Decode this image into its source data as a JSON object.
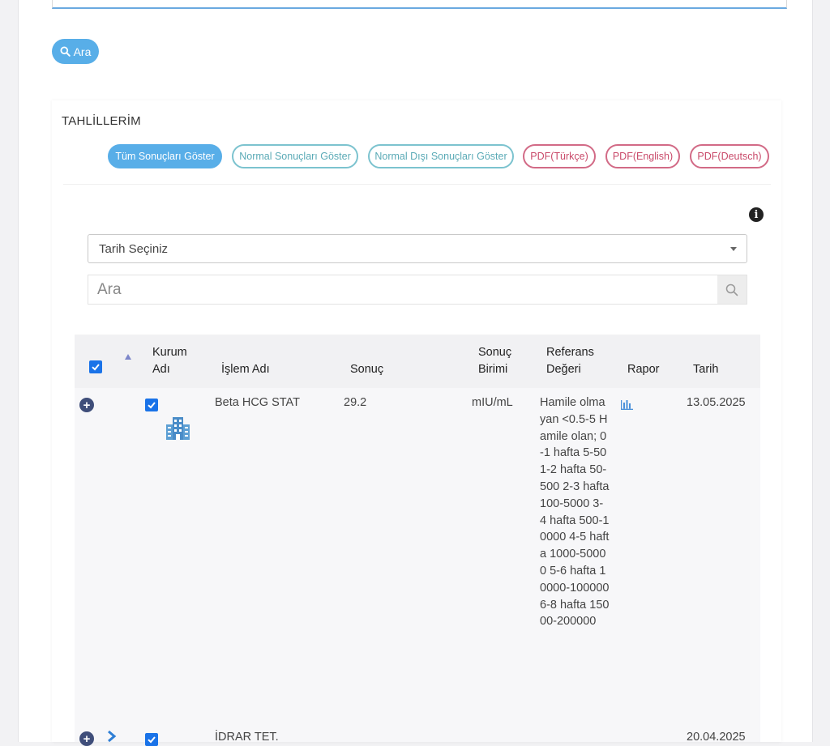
{
  "search_button": {
    "label": "Ara",
    "icon": "search-icon"
  },
  "panel": {
    "title": "TAHLİLLERİM",
    "filters": {
      "all": "Tüm Sonuçları Göster",
      "normal": "Normal Sonuçları Göster",
      "abnormal": "Normal Dışı Sonuçları Göster",
      "pdf_tr": "PDF(Türkçe)",
      "pdf_en": "PDF(English)",
      "pdf_de": "PDF(Deutsch)"
    },
    "info_icon": "info-icon"
  },
  "date_select": {
    "value": "Tarih Seçiniz"
  },
  "table_search": {
    "placeholder": "Ara"
  },
  "table": {
    "headers": {
      "kurum": "Kurum Adı",
      "islem": "İşlem Adı",
      "sonuc": "Sonuç",
      "birim": "Sonuç Birimi",
      "referans": "Referans Değeri",
      "rapor": "Rapor",
      "tarih": "Tarih"
    },
    "rows": [
      {
        "islem": "Beta HCG STAT",
        "sonuc": "29.2",
        "birim": "mIU/mL",
        "referans": "Hamile olmayan <0.5-5 Hamile olan; 0-1 hafta 5-50 1-2 hafta 50-500 2-3 hafta 100-5000 3-4 hafta 500-10000 4-5 hafta 1000-50000 5-6 hafta 10000-100000 6-8 hafta 15000-200000",
        "tarih": "13.05.2025",
        "checked": true
      },
      {
        "islem": "İDRAR TET.",
        "tarih": "20.04.2025",
        "checked": true
      }
    ]
  },
  "colors": {
    "primary": "#58aee8",
    "teal": "#7cc3cf",
    "pdf": "#d26a86",
    "checkbox": "#1a73e8",
    "expand": "#3f4e7a"
  }
}
